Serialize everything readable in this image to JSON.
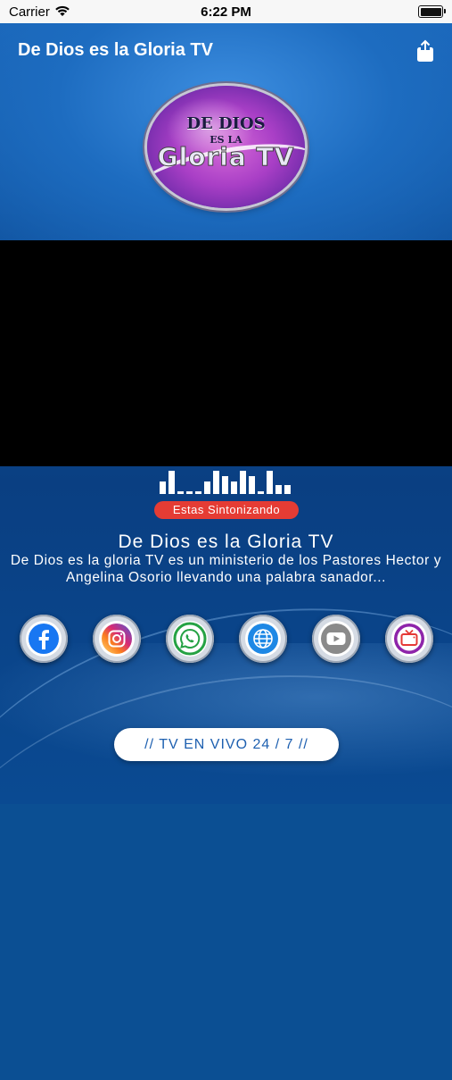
{
  "status_bar": {
    "carrier": "Carrier",
    "time": "6:22 PM"
  },
  "nav": {
    "title": "De Dios es la Gloria TV"
  },
  "logo": {
    "line1": "DE DIOS",
    "line2": "ES LA",
    "line3": "Gloria TV"
  },
  "now_playing": {
    "badge": "Estas Sintonizando",
    "title": "De Dios es la Gloria TV",
    "description": "De Dios es la gloria TV es un ministerio de los Pastores Hector y Angelina Osorio llevando una palabra sanador..."
  },
  "social": [
    {
      "name": "facebook-icon",
      "color": "#1877f2"
    },
    {
      "name": "instagram-icon",
      "color": "#e1306c"
    },
    {
      "name": "whatsapp-icon",
      "color": "#25a244"
    },
    {
      "name": "website-icon",
      "color": "#1e88e5"
    },
    {
      "name": "youtube-icon",
      "color": "#8a8a8a"
    },
    {
      "name": "tv-icon",
      "color": "#8e24aa"
    }
  ],
  "live_button": {
    "label": "//  TV EN VIVO 24 / 7 //"
  }
}
